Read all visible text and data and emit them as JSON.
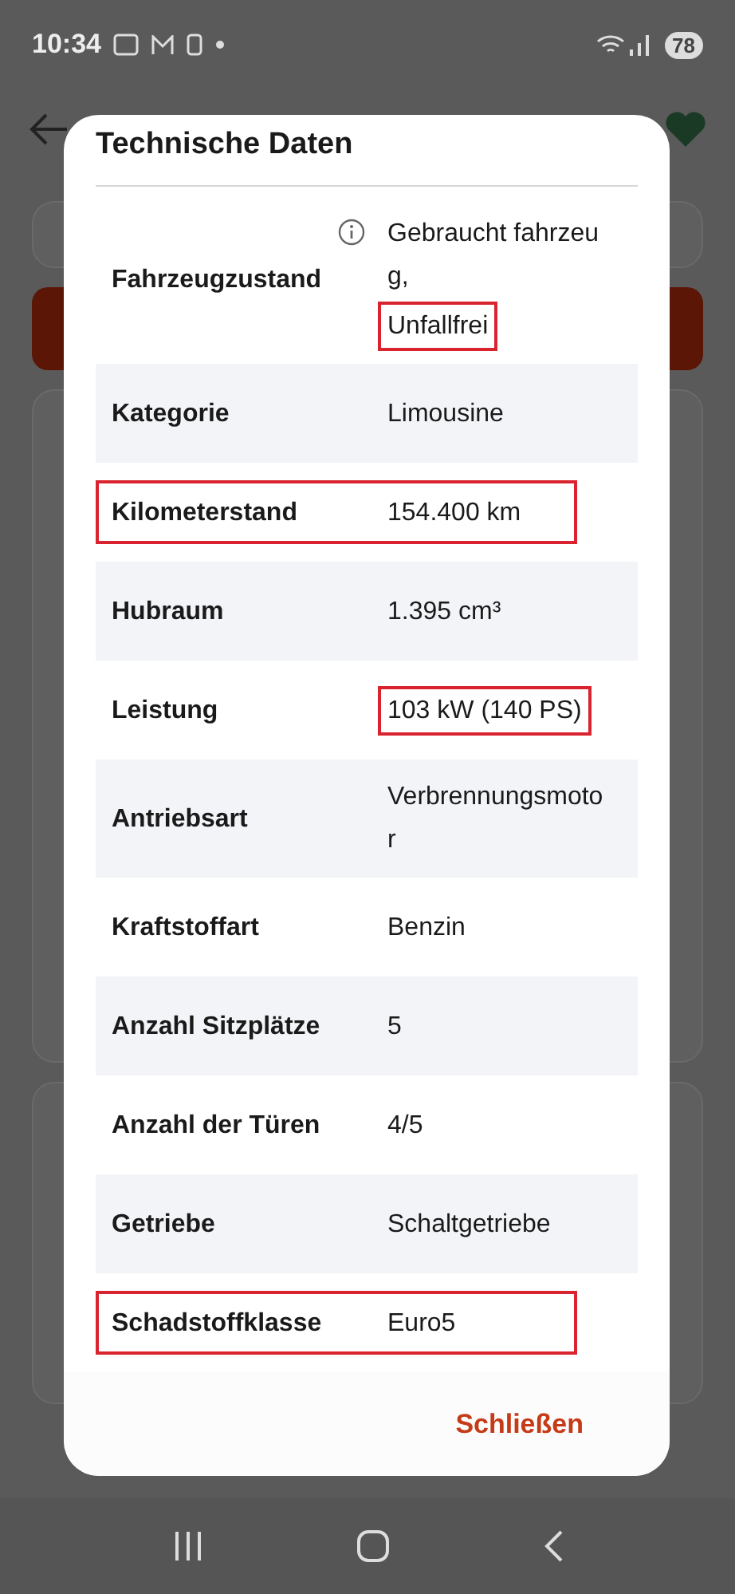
{
  "status_bar": {
    "time": "10:34",
    "battery": "78"
  },
  "dialog": {
    "title": "Technische Daten",
    "rows": [
      {
        "label": "Fahrzeugzustand",
        "info": true,
        "marked": false,
        "value": [
          {
            "text": "Gebraucht fahrzeug,",
            "marked": false
          },
          {
            "text": "Unfallfrei",
            "marked": true
          }
        ]
      },
      {
        "label": "Kategorie",
        "info": false,
        "marked": false,
        "value": [
          {
            "text": "Limousine",
            "marked": false
          }
        ]
      },
      {
        "label": "Kilometerstand",
        "info": false,
        "marked": true,
        "value": [
          {
            "text": "154.400 km",
            "marked": false
          }
        ]
      },
      {
        "label": "Hubraum",
        "info": false,
        "marked": false,
        "value": [
          {
            "text": "1.395 cm³",
            "marked": false
          }
        ]
      },
      {
        "label": "Leistung",
        "info": false,
        "marked": false,
        "value": [
          {
            "text": "103 kW (140 PS)",
            "marked": true
          }
        ]
      },
      {
        "label": "Antriebsart",
        "info": false,
        "marked": false,
        "value": [
          {
            "text": "Verbrennungsmotor",
            "marked": false
          }
        ]
      },
      {
        "label": "Kraftstoffart",
        "info": false,
        "marked": false,
        "value": [
          {
            "text": "Benzin",
            "marked": false
          }
        ]
      },
      {
        "label": "Anzahl Sitzplätze",
        "info": false,
        "marked": false,
        "value": [
          {
            "text": "5",
            "marked": false
          }
        ]
      },
      {
        "label": "Anzahl der Türen",
        "info": false,
        "marked": false,
        "value": [
          {
            "text": "4/5",
            "marked": false
          }
        ]
      },
      {
        "label": "Getriebe",
        "info": false,
        "marked": false,
        "value": [
          {
            "text": "Schaltgetriebe",
            "marked": false
          }
        ]
      },
      {
        "label": "Schadstoffklasse",
        "info": false,
        "marked": true,
        "value": [
          {
            "text": "Euro5",
            "marked": false
          }
        ]
      }
    ],
    "close_button": "Schließen"
  }
}
